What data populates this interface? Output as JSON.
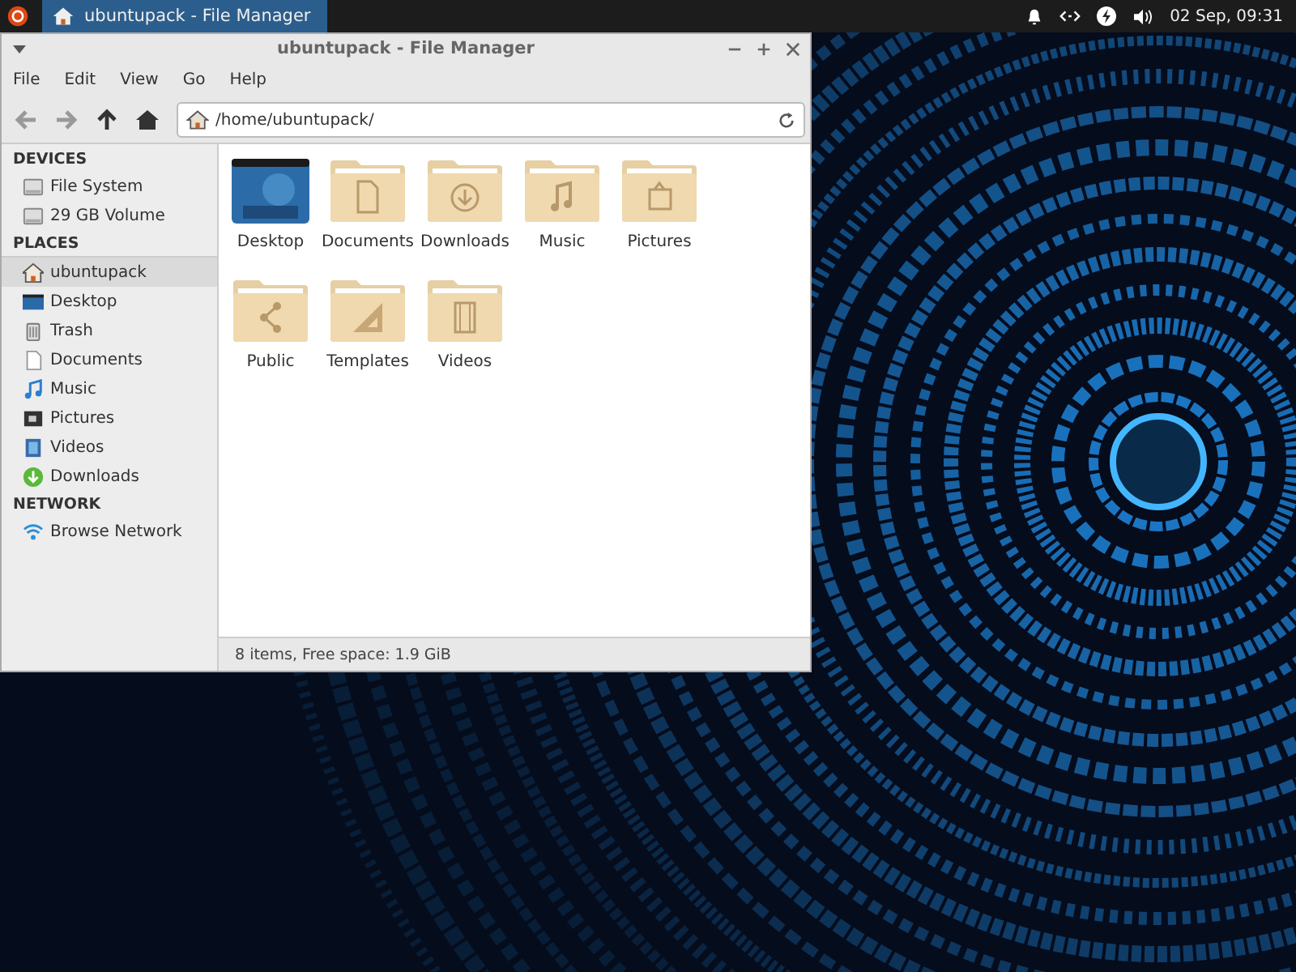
{
  "panel": {
    "taskbar_items": [
      {
        "label": "ubuntupack - File Manager",
        "selected": true
      }
    ],
    "clock": "02 Sep, 09:31"
  },
  "window": {
    "title": "ubuntupack - File Manager",
    "menu": [
      "File",
      "Edit",
      "View",
      "Go",
      "Help"
    ],
    "location": "/home/ubuntupack/",
    "sidebar": [
      {
        "heading": "DEVICES",
        "items": [
          {
            "label": "File System",
            "kind": "drive",
            "selected": false
          },
          {
            "label": "29 GB Volume",
            "kind": "drive",
            "selected": false
          }
        ]
      },
      {
        "heading": "PLACES",
        "items": [
          {
            "label": "ubuntupack",
            "kind": "home",
            "selected": true
          },
          {
            "label": "Desktop",
            "kind": "desktop",
            "selected": false
          },
          {
            "label": "Trash",
            "kind": "trash",
            "selected": false
          },
          {
            "label": "Documents",
            "kind": "document",
            "selected": false
          },
          {
            "label": "Music",
            "kind": "music",
            "selected": false
          },
          {
            "label": "Pictures",
            "kind": "pictures",
            "selected": false
          },
          {
            "label": "Videos",
            "kind": "videos",
            "selected": false
          },
          {
            "label": "Downloads",
            "kind": "downloads",
            "selected": false
          }
        ]
      },
      {
        "heading": "NETWORK",
        "items": [
          {
            "label": "Browse Network",
            "kind": "network",
            "selected": false
          }
        ]
      }
    ],
    "files": [
      {
        "name": "Desktop",
        "kind": "desktop"
      },
      {
        "name": "Documents",
        "kind": "document"
      },
      {
        "name": "Downloads",
        "kind": "downloads"
      },
      {
        "name": "Music",
        "kind": "music"
      },
      {
        "name": "Pictures",
        "kind": "pictures"
      },
      {
        "name": "Public",
        "kind": "share"
      },
      {
        "name": "Templates",
        "kind": "template"
      },
      {
        "name": "Videos",
        "kind": "videos"
      }
    ],
    "status_bar": "8 items, Free space: 1.9 GiB"
  }
}
